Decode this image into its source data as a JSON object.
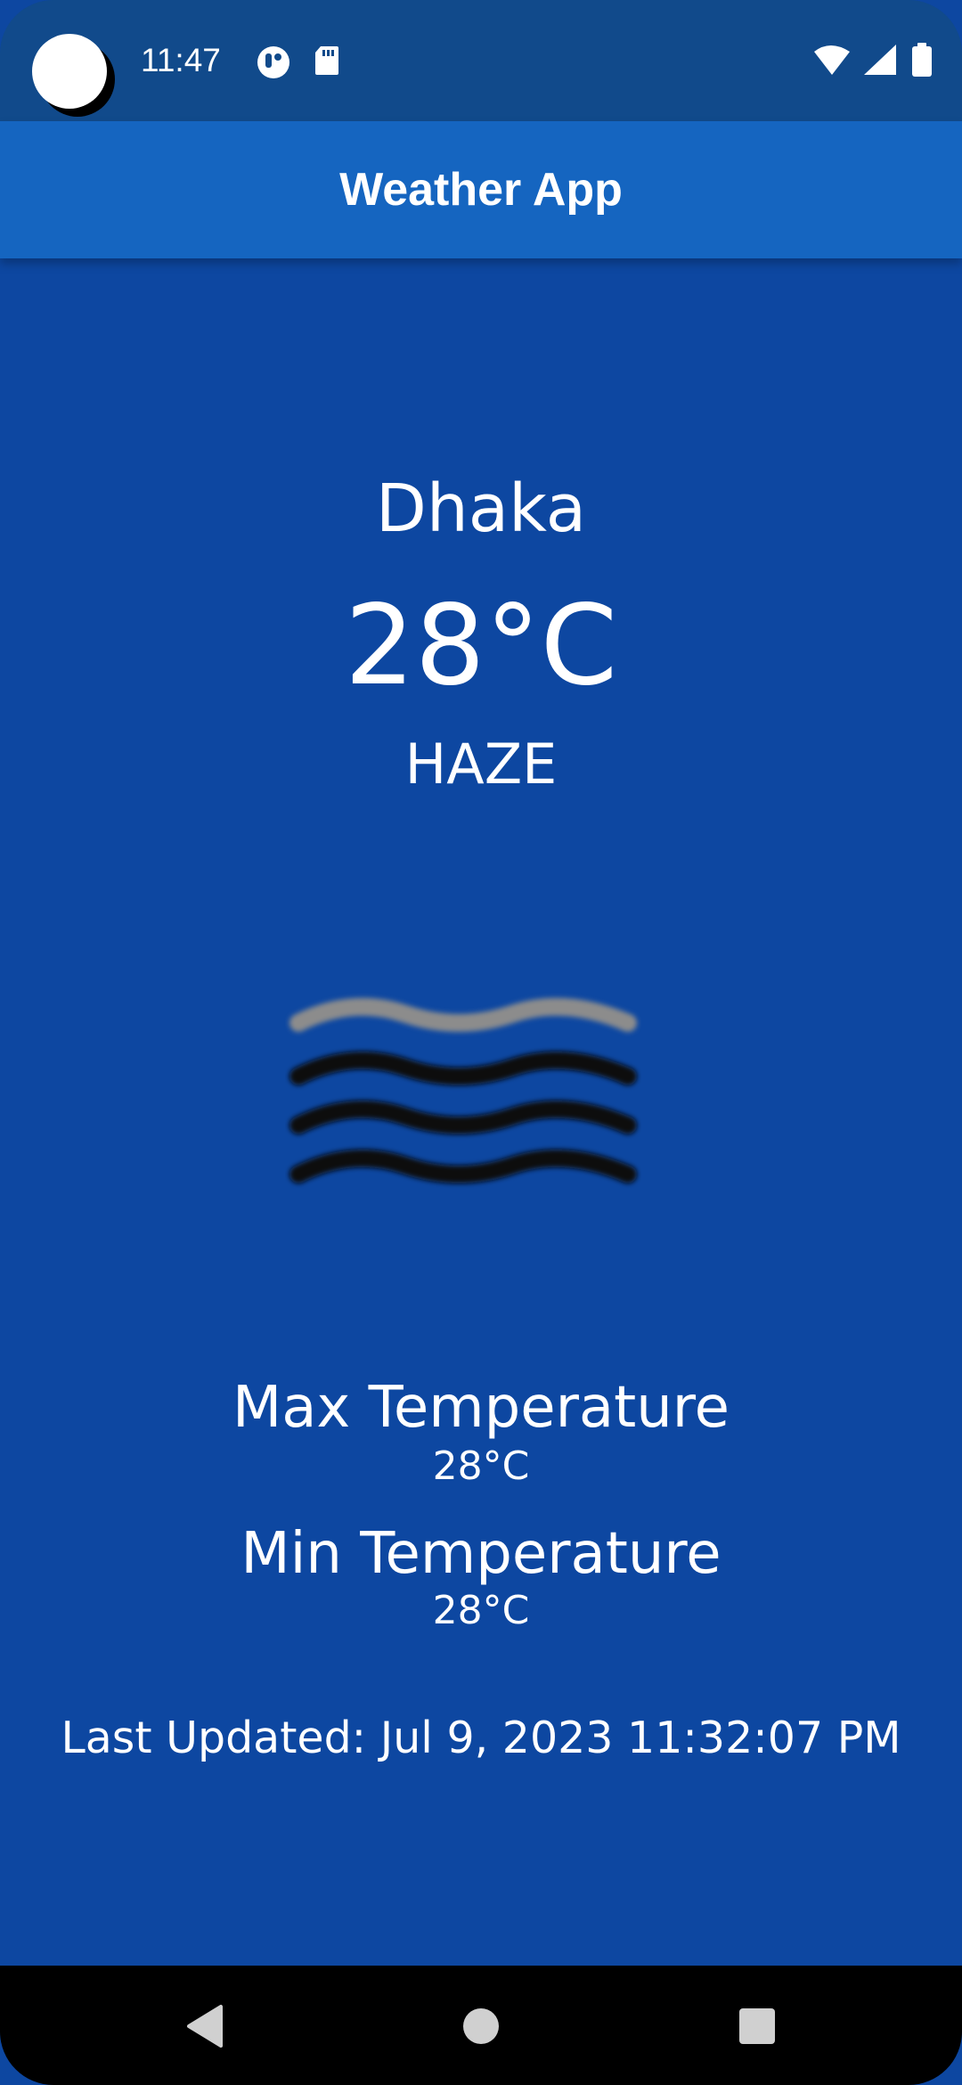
{
  "status_bar": {
    "time": "11:47",
    "left_icons": [
      "notification-app-icon",
      "sd-card-icon"
    ],
    "right_icons": [
      "wifi-icon",
      "cellular-signal-icon",
      "battery-icon"
    ]
  },
  "app_bar": {
    "title": "Weather App"
  },
  "weather": {
    "city": "Dhaka",
    "temperature": "28°C",
    "condition": "HAZE",
    "icon": "haze-icon",
    "max_label": "Max Temperature",
    "max_value": "28°C",
    "min_label": "Min Temperature",
    "min_value": "28°C",
    "last_updated": "Last Updated: Jul 9, 2023 11:32:07 PM"
  },
  "nav_bar": {
    "icons": [
      "back-icon",
      "home-icon",
      "recents-icon"
    ]
  },
  "colors": {
    "background": "#0d47a1",
    "status_bar": "#114a8b",
    "app_bar": "#1565c0",
    "text": "#ffffff"
  }
}
